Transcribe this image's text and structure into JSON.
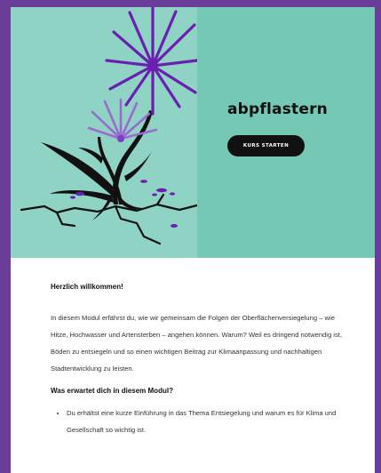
{
  "course": {
    "title": "abpflastern",
    "start_button": "KURS STARTEN"
  },
  "welcome": {
    "heading": "Herzlich willkommen!",
    "paragraph": "In diesem Modul erfährst du, wie wir gemeinsam die Folgen der Oberflächenversiegelung – wie Hitze, Hochwasser und Artensterben – angehen können. Warum? Weil es dringend notwendig ist, Böden zu entsiegeln und so einen wichtigen Beitrag zur Klimaanpassung und nachhaltigen Stadtentwicklung zu leisten."
  },
  "expectations": {
    "heading": "Was erwartet dich in diesem Modul?",
    "items": [
      "Du erhältst eine kurze Einführung in das Thema Entsiegelung und warum es für Klima und Gesellschaft so wichtig ist."
    ]
  },
  "colors": {
    "background": "#6a3d98",
    "hero": "#74c8b4",
    "hero_art": "#8fd3c4",
    "flower": "#6b1fb1",
    "button": "#111111"
  },
  "icons": {
    "hero_illustration": "plant-growing-through-cracked-pavement"
  }
}
